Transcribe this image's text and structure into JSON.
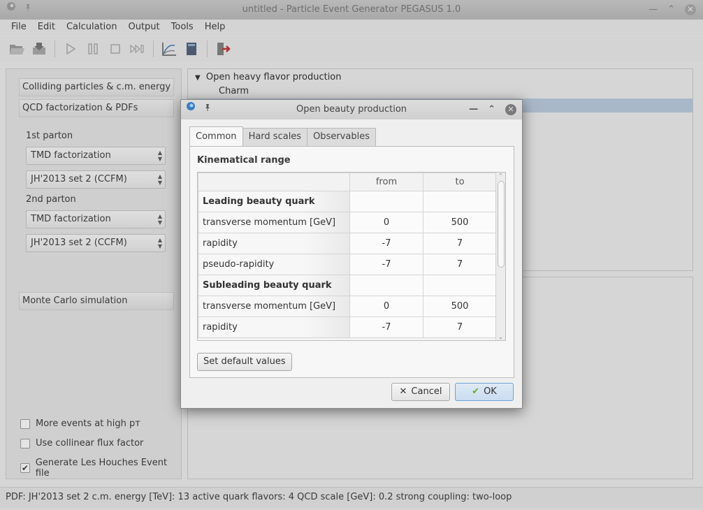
{
  "window": {
    "title": "untitled - Particle Event Generator PEGASUS 1.0"
  },
  "menu": [
    "File",
    "Edit",
    "Calculation",
    "Output",
    "Tools",
    "Help"
  ],
  "toolbar": {
    "icons": [
      "open-icon",
      "save-icon",
      "play-icon",
      "pause-icon",
      "stop-icon",
      "fast-forward-icon",
      "graph-icon",
      "book-icon",
      "exit-icon"
    ]
  },
  "left": {
    "group1": "Colliding particles & c.m. energy",
    "group2": "QCD factorization & PDFs",
    "parton1_label": "1st parton",
    "parton1_fact": "TMD factorization",
    "parton1_pdf": "JH'2013 set 2 (CCFM)",
    "parton2_label": "2nd parton",
    "parton2_fact": "TMD factorization",
    "parton2_pdf": "JH'2013 set 2 (CCFM)",
    "group3": "Monte Carlo simulation",
    "checks": [
      {
        "label": "More events at high pᴛ",
        "checked": false
      },
      {
        "label": "Use collinear flux factor",
        "checked": false
      },
      {
        "label": "Generate Les Houches Event file",
        "checked": true
      }
    ]
  },
  "tree": {
    "root": "Open heavy flavor production",
    "child1": "Charm"
  },
  "status": "PDF: JH'2013 set 2   c.m. energy [TeV]: 13   active quark flavors: 4   QCD scale [GeV]: 0.2   strong coupling: two-loop",
  "dialog": {
    "title": "Open beauty production",
    "tabs": [
      "Common",
      "Hard scales",
      "Observables"
    ],
    "section": "Kinematical range",
    "headers": [
      "",
      "from",
      "to"
    ],
    "rows": [
      {
        "label": "Leading beauty quark",
        "from": "",
        "to": "",
        "section": true
      },
      {
        "label": "transverse momentum [GeV]",
        "from": "0",
        "to": "500",
        "section": false
      },
      {
        "label": "rapidity",
        "from": "-7",
        "to": "7",
        "section": false
      },
      {
        "label": "pseudo-rapidity",
        "from": "-7",
        "to": "7",
        "section": false
      },
      {
        "label": "Subleading beauty quark",
        "from": "",
        "to": "",
        "section": true
      },
      {
        "label": "transverse momentum [GeV]",
        "from": "0",
        "to": "500",
        "section": false
      },
      {
        "label": "rapidity",
        "from": "-7",
        "to": "7",
        "section": false
      }
    ],
    "default_button": "Set default values",
    "cancel": "Cancel",
    "ok": "OK"
  },
  "colors": {
    "accent": "#6fa2d6",
    "ok_check": "#5fae2e",
    "exit_red": "#b03030"
  }
}
